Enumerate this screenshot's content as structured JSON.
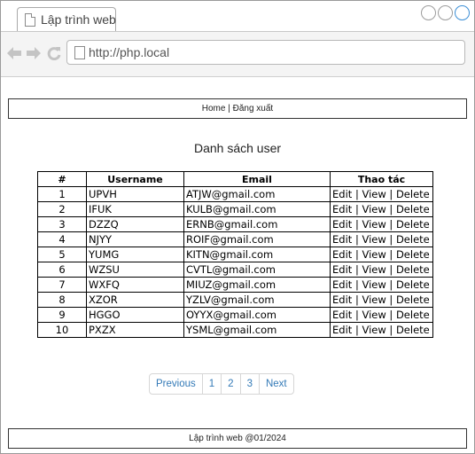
{
  "browser": {
    "tab_title": "Lập trình web",
    "url": "http://php.local"
  },
  "header": {
    "home": "Home",
    "separator": "|",
    "logout": "Đăng xuất"
  },
  "page_title": "Danh sách user",
  "table": {
    "columns": [
      "#",
      "Username",
      "Email",
      "Thao tác"
    ],
    "rows": [
      {
        "num": "1",
        "username": "UPVH",
        "email": "ATJW@gmail.com"
      },
      {
        "num": "2",
        "username": "IFUK",
        "email": "KULB@gmail.com"
      },
      {
        "num": "3",
        "username": "DZZQ",
        "email": "ERNB@gmail.com"
      },
      {
        "num": "4",
        "username": "NJYY",
        "email": "ROIF@gmail.com"
      },
      {
        "num": "5",
        "username": "YUMG",
        "email": "KITN@gmail.com"
      },
      {
        "num": "6",
        "username": "WZSU",
        "email": "CVTL@gmail.com"
      },
      {
        "num": "7",
        "username": "WXFQ",
        "email": "MIUZ@gmail.com"
      },
      {
        "num": "8",
        "username": "XZOR",
        "email": "YZLV@gmail.com"
      },
      {
        "num": "9",
        "username": "HGGO",
        "email": "OYYX@gmail.com"
      },
      {
        "num": "10",
        "username": "PXZX",
        "email": "YSML@gmail.com"
      }
    ],
    "actions": {
      "edit": "Edit",
      "view": "View",
      "delete": "Delete",
      "sep": "|"
    }
  },
  "pagination": {
    "previous": "Previous",
    "pages": [
      "1",
      "2",
      "3"
    ],
    "next": "Next"
  },
  "footer": {
    "text": "Lập trình web @01/2024"
  },
  "colors": {
    "link": "#337ab7",
    "window_control_active": "#3c8fd6"
  }
}
